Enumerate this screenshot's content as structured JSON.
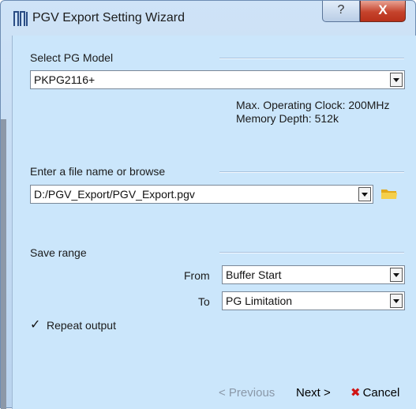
{
  "window": {
    "title": "PGV Export Setting Wizard",
    "help_glyph": "?",
    "close_glyph": "X"
  },
  "pg_model": {
    "section_label": "Select PG Model",
    "selected": "PKPG2116+",
    "info_clock": "Max. Operating Clock: 200MHz",
    "info_memory": "Memory Depth: 512k"
  },
  "file": {
    "section_label": "Enter a file name or browse",
    "value": "D:/PGV_Export/PGV_Export.pgv"
  },
  "save_range": {
    "section_label": "Save range",
    "from_label": "From",
    "from_value": "Buffer Start",
    "to_label": "To",
    "to_value": "PG Limitation"
  },
  "repeat": {
    "checked": true,
    "check_glyph": "✓",
    "label": "Repeat output"
  },
  "buttons": {
    "previous": "< Previous",
    "next": "Next >",
    "cancel_icon": "✖",
    "cancel": "Cancel"
  },
  "colors": {
    "panel_bg": "#cbe6fb",
    "title_bg": "#cfe3f7",
    "close_red": "#c5432c",
    "cancel_x": "#d01414",
    "folder_yellow": "#f2c230"
  }
}
